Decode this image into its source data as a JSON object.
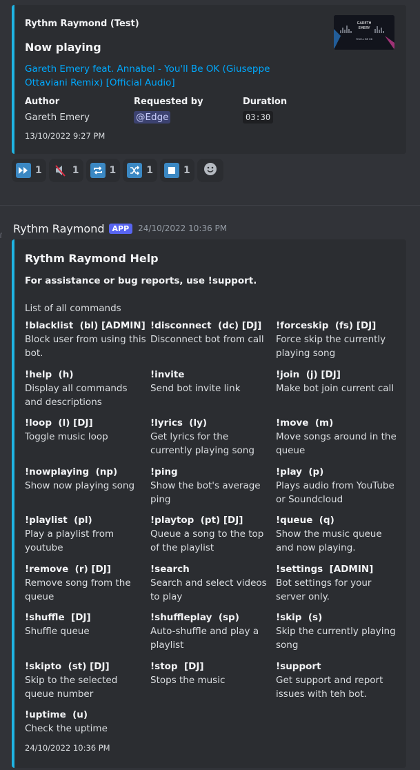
{
  "now_playing": {
    "author": "Rythm Raymond (Test)",
    "title": "Now playing",
    "link": "Gareth Emery feat. Annabel - You'll Be OK (Giuseppe Ottaviani Remix) [Official Audio]",
    "fields": [
      {
        "name": "Author",
        "value": "Gareth Emery"
      },
      {
        "name": "Requested by",
        "value": "@Edge"
      },
      {
        "name": "Duration",
        "value": "03:30"
      }
    ],
    "footer": "13/10/2022 9:27 PM",
    "thumbnail_text": {
      "line1": "GARETH",
      "line2": "EMERY",
      "line3": "YOU'LL BE OK"
    }
  },
  "reactions": [
    {
      "icon": "fast-forward-icon",
      "count": "1"
    },
    {
      "icon": "mute-icon",
      "count": "1"
    },
    {
      "icon": "repeat-icon",
      "count": "1"
    },
    {
      "icon": "shuffle-icon",
      "count": "1"
    },
    {
      "icon": "stop-icon",
      "count": "1"
    }
  ],
  "message": {
    "username": "Rythm Raymond",
    "badge": "APP",
    "timestamp": "24/10/2022 10:36 PM"
  },
  "help": {
    "title": "Rythm Raymond Help",
    "bold_line": "For assistance or bug reports, use !support.",
    "subtitle": "List of all commands",
    "commands": [
      {
        "name": "!blacklist  (bl) [ADMIN]",
        "desc": "Block user from using this bot."
      },
      {
        "name": "!disconnect  (dc) [DJ]",
        "desc": "Disconnect bot from call"
      },
      {
        "name": "!forceskip  (fs) [DJ]",
        "desc": "Force skip the currently playing song"
      },
      {
        "name": "!help  (h)",
        "desc": "Display all commands and descriptions"
      },
      {
        "name": "!invite",
        "desc": "Send bot invite link"
      },
      {
        "name": "!join  (j) [DJ]",
        "desc": "Make bot join current call"
      },
      {
        "name": "!loop  (l) [DJ]",
        "desc": "Toggle music loop"
      },
      {
        "name": "!lyrics  (ly)",
        "desc": "Get lyrics for the currently playing song"
      },
      {
        "name": "!move  (m)",
        "desc": "Move songs around in the queue"
      },
      {
        "name": "!nowplaying  (np)",
        "desc": "Show now playing song"
      },
      {
        "name": "!ping",
        "desc": "Show the bot's average ping"
      },
      {
        "name": "!play  (p)",
        "desc": "Plays audio from YouTube or Soundcloud"
      },
      {
        "name": "!playlist  (pl)",
        "desc": "Play a playlist from youtube"
      },
      {
        "name": "!playtop  (pt) [DJ]",
        "desc": "Queue a song to the top of the playlist"
      },
      {
        "name": "!queue  (q)",
        "desc": "Show the music queue and now playing."
      },
      {
        "name": "!remove  (r) [DJ]",
        "desc": "Remove song from the queue"
      },
      {
        "name": "!search",
        "desc": "Search and select videos to play"
      },
      {
        "name": "!settings  [ADMIN]",
        "desc": "Bot settings for your server only."
      },
      {
        "name": "!shuffle  [DJ]",
        "desc": "Shuffle queue"
      },
      {
        "name": "!shuffleplay  (sp)",
        "desc": "Auto-shuffle and play a playlist"
      },
      {
        "name": "!skip  (s)",
        "desc": "Skip the currently playing song"
      },
      {
        "name": "!skipto  (st) [DJ]",
        "desc": "Skip to the selected queue number"
      },
      {
        "name": "!stop  [DJ]",
        "desc": "Stops the music"
      },
      {
        "name": "!support",
        "desc": "Get support and report issues with teh bot."
      },
      {
        "name": "!uptime  (u)",
        "desc": "Check the uptime"
      }
    ],
    "footer": "24/10/2022 10:36 PM"
  },
  "colors": {
    "background": "#313338",
    "embed": "#2b2d31",
    "embed_accent": "#1fb4e3",
    "link": "#00a8fc",
    "app_badge": "#5865f2"
  }
}
